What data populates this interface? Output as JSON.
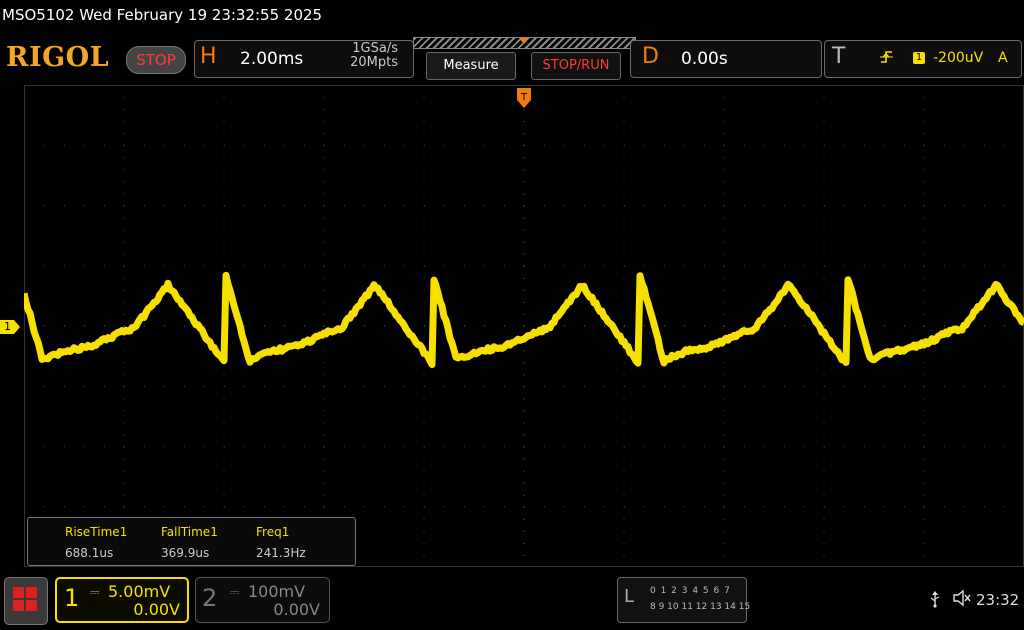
{
  "header": {
    "title": "MSO5102  Wed February 19 23:32:55 2025",
    "logo": "RIGOL",
    "run_state": "STOP"
  },
  "horizontal": {
    "letter": "H",
    "timebase": "2.00ms",
    "sample_rate": "1GSa/s",
    "memory_depth": "20Mpts"
  },
  "toolbar": {
    "measure_label": "Measure",
    "stoprun_label": "STOP/RUN"
  },
  "delay": {
    "letter": "D",
    "value": "0.00s"
  },
  "trigger": {
    "letter": "T",
    "source": "1",
    "level": "-200uV",
    "mode": "A"
  },
  "channel_marker": "1",
  "measurements": [
    {
      "label": "RiseTime1",
      "value": "688.1us"
    },
    {
      "label": "FallTime1",
      "value": "369.9us"
    },
    {
      "label": "Freq1",
      "value": "241.3Hz"
    }
  ],
  "channels": [
    {
      "number": "1",
      "scale": "5.00mV",
      "offset": "0.00V",
      "color": "#f5e000",
      "active": true
    },
    {
      "number": "2",
      "scale": "100mV",
      "offset": "0.00V",
      "color": "#888888",
      "active": false
    }
  ],
  "logic": {
    "letter": "L",
    "row1": "0 1 2 3  4 5 6 7",
    "row2": "8 9 10 11 12 13 14 15"
  },
  "status": {
    "usb_icon": "usb-icon",
    "sound_icon": "speaker-muted-icon",
    "time": "23:32"
  },
  "colors": {
    "trace": "#f5e000",
    "accent": "#f07c10",
    "stop": "#ff3838"
  }
}
